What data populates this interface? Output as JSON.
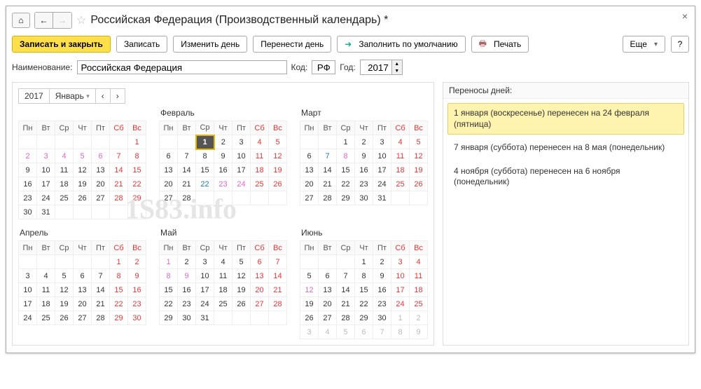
{
  "titlebar": {
    "title": "Российская Федерация (Производственный календарь) *"
  },
  "toolbar": {
    "save_close": "Записать и закрыть",
    "save": "Записать",
    "change_day": "Изменить день",
    "move_day": "Перенести день",
    "fill_default": "Заполнить по умолчанию",
    "print": "Печать",
    "more": "Еще",
    "help": "?"
  },
  "form": {
    "name_label": "Наименование:",
    "name_value": "Российская Федерация",
    "code_label": "Код:",
    "code_value": "РФ",
    "year_label": "Год:",
    "year_value": "2017"
  },
  "year_nav": {
    "year": "2017",
    "month": "Январь"
  },
  "dow": [
    "Пн",
    "Вт",
    "Ср",
    "Чт",
    "Пт",
    "Сб",
    "Вс"
  ],
  "months": [
    {
      "name": "Январь",
      "rows": [
        [
          {
            "": null
          },
          {
            "": null
          },
          {
            "": null
          },
          {
            "": null
          },
          {
            "": null
          },
          {
            "": null
          },
          {
            "v": "1",
            "c": "wknd"
          }
        ],
        [
          {
            "v": "2",
            "c": "hol"
          },
          {
            "v": "3",
            "c": "hol"
          },
          {
            "v": "4",
            "c": "hol"
          },
          {
            "v": "5",
            "c": "hol"
          },
          {
            "v": "6",
            "c": "hol"
          },
          {
            "v": "7",
            "c": "wknd"
          },
          {
            "v": "8",
            "c": "wknd"
          }
        ],
        [
          {
            "v": "9"
          },
          {
            "v": "10"
          },
          {
            "v": "11"
          },
          {
            "v": "12"
          },
          {
            "v": "13"
          },
          {
            "v": "14",
            "c": "wknd"
          },
          {
            "v": "15",
            "c": "wknd"
          }
        ],
        [
          {
            "v": "16"
          },
          {
            "v": "17"
          },
          {
            "v": "18"
          },
          {
            "v": "19"
          },
          {
            "v": "20"
          },
          {
            "v": "21",
            "c": "wknd"
          },
          {
            "v": "22",
            "c": "wknd"
          }
        ],
        [
          {
            "v": "23"
          },
          {
            "v": "24"
          },
          {
            "v": "25"
          },
          {
            "v": "26"
          },
          {
            "v": "27"
          },
          {
            "v": "28",
            "c": "wknd"
          },
          {
            "v": "29",
            "c": "wknd"
          }
        ],
        [
          {
            "v": "30"
          },
          {
            "v": "31"
          },
          {
            "": null
          },
          {
            "": null
          },
          {
            "": null
          },
          {
            "": null
          },
          {
            "": null
          }
        ]
      ]
    },
    {
      "name": "Февраль",
      "rows": [
        [
          {
            "": null
          },
          {
            "": null
          },
          {
            "v": "1",
            "c": "sel"
          },
          {
            "v": "2"
          },
          {
            "v": "3"
          },
          {
            "v": "4",
            "c": "wknd"
          },
          {
            "v": "5",
            "c": "wknd"
          }
        ],
        [
          {
            "v": "6"
          },
          {
            "v": "7"
          },
          {
            "v": "8"
          },
          {
            "v": "9"
          },
          {
            "v": "10"
          },
          {
            "v": "11",
            "c": "wknd"
          },
          {
            "v": "12",
            "c": "wknd"
          }
        ],
        [
          {
            "v": "13"
          },
          {
            "v": "14"
          },
          {
            "v": "15"
          },
          {
            "v": "16"
          },
          {
            "v": "17"
          },
          {
            "v": "18",
            "c": "wknd"
          },
          {
            "v": "19",
            "c": "wknd"
          }
        ],
        [
          {
            "v": "20"
          },
          {
            "v": "21"
          },
          {
            "v": "22",
            "c": "pre"
          },
          {
            "v": "23",
            "c": "hol"
          },
          {
            "v": "24",
            "c": "hol"
          },
          {
            "v": "25",
            "c": "wknd"
          },
          {
            "v": "26",
            "c": "wknd"
          }
        ],
        [
          {
            "v": "27"
          },
          {
            "v": "28"
          },
          {
            "": null
          },
          {
            "": null
          },
          {
            "": null
          },
          {
            "": null
          },
          {
            "": null
          }
        ]
      ]
    },
    {
      "name": "Март",
      "rows": [
        [
          {
            "": null
          },
          {
            "": null
          },
          {
            "v": "1"
          },
          {
            "v": "2"
          },
          {
            "v": "3"
          },
          {
            "v": "4",
            "c": "wknd"
          },
          {
            "v": "5",
            "c": "wknd"
          }
        ],
        [
          {
            "v": "6"
          },
          {
            "v": "7",
            "c": "pre"
          },
          {
            "v": "8",
            "c": "hol"
          },
          {
            "v": "9"
          },
          {
            "v": "10"
          },
          {
            "v": "11",
            "c": "wknd"
          },
          {
            "v": "12",
            "c": "wknd"
          }
        ],
        [
          {
            "v": "13"
          },
          {
            "v": "14"
          },
          {
            "v": "15"
          },
          {
            "v": "16"
          },
          {
            "v": "17"
          },
          {
            "v": "18",
            "c": "wknd"
          },
          {
            "v": "19",
            "c": "wknd"
          }
        ],
        [
          {
            "v": "20"
          },
          {
            "v": "21"
          },
          {
            "v": "22"
          },
          {
            "v": "23"
          },
          {
            "v": "24"
          },
          {
            "v": "25",
            "c": "wknd"
          },
          {
            "v": "26",
            "c": "wknd"
          }
        ],
        [
          {
            "v": "27"
          },
          {
            "v": "28"
          },
          {
            "v": "29"
          },
          {
            "v": "30"
          },
          {
            "v": "31"
          },
          {
            "": null
          },
          {
            "": null
          }
        ]
      ]
    },
    {
      "name": "Апрель",
      "rows": [
        [
          {
            "": null
          },
          {
            "": null
          },
          {
            "": null
          },
          {
            "": null
          },
          {
            "": null
          },
          {
            "v": "1",
            "c": "wknd"
          },
          {
            "v": "2",
            "c": "wknd"
          }
        ],
        [
          {
            "v": "3"
          },
          {
            "v": "4"
          },
          {
            "v": "5"
          },
          {
            "v": "6"
          },
          {
            "v": "7"
          },
          {
            "v": "8",
            "c": "wknd"
          },
          {
            "v": "9",
            "c": "wknd"
          }
        ],
        [
          {
            "v": "10"
          },
          {
            "v": "11"
          },
          {
            "v": "12"
          },
          {
            "v": "13"
          },
          {
            "v": "14"
          },
          {
            "v": "15",
            "c": "wknd"
          },
          {
            "v": "16",
            "c": "wknd"
          }
        ],
        [
          {
            "v": "17"
          },
          {
            "v": "18"
          },
          {
            "v": "19"
          },
          {
            "v": "20"
          },
          {
            "v": "21"
          },
          {
            "v": "22",
            "c": "wknd"
          },
          {
            "v": "23",
            "c": "wknd"
          }
        ],
        [
          {
            "v": "24"
          },
          {
            "v": "25"
          },
          {
            "v": "26"
          },
          {
            "v": "27"
          },
          {
            "v": "28"
          },
          {
            "v": "29",
            "c": "wknd"
          },
          {
            "v": "30",
            "c": "wknd"
          }
        ]
      ]
    },
    {
      "name": "Май",
      "rows": [
        [
          {
            "v": "1",
            "c": "hol"
          },
          {
            "v": "2"
          },
          {
            "v": "3"
          },
          {
            "v": "4"
          },
          {
            "v": "5"
          },
          {
            "v": "6",
            "c": "wknd"
          },
          {
            "v": "7",
            "c": "wknd"
          }
        ],
        [
          {
            "v": "8",
            "c": "hol"
          },
          {
            "v": "9",
            "c": "hol"
          },
          {
            "v": "10"
          },
          {
            "v": "11"
          },
          {
            "v": "12"
          },
          {
            "v": "13",
            "c": "wknd"
          },
          {
            "v": "14",
            "c": "wknd"
          }
        ],
        [
          {
            "v": "15"
          },
          {
            "v": "16"
          },
          {
            "v": "17"
          },
          {
            "v": "18"
          },
          {
            "v": "19"
          },
          {
            "v": "20",
            "c": "wknd"
          },
          {
            "v": "21",
            "c": "wknd"
          }
        ],
        [
          {
            "v": "22"
          },
          {
            "v": "23"
          },
          {
            "v": "24"
          },
          {
            "v": "25"
          },
          {
            "v": "26"
          },
          {
            "v": "27",
            "c": "wknd"
          },
          {
            "v": "28",
            "c": "wknd"
          }
        ],
        [
          {
            "v": "29"
          },
          {
            "v": "30"
          },
          {
            "v": "31"
          },
          {
            "": null
          },
          {
            "": null
          },
          {
            "": null
          },
          {
            "": null
          }
        ]
      ]
    },
    {
      "name": "Июнь",
      "rows": [
        [
          {
            "": null
          },
          {
            "": null
          },
          {
            "": null
          },
          {
            "v": "1"
          },
          {
            "v": "2"
          },
          {
            "v": "3",
            "c": "wknd"
          },
          {
            "v": "4",
            "c": "wknd"
          }
        ],
        [
          {
            "v": "5"
          },
          {
            "v": "6"
          },
          {
            "v": "7"
          },
          {
            "v": "8"
          },
          {
            "v": "9"
          },
          {
            "v": "10",
            "c": "wknd"
          },
          {
            "v": "11",
            "c": "wknd"
          }
        ],
        [
          {
            "v": "12",
            "c": "hol"
          },
          {
            "v": "13"
          },
          {
            "v": "14"
          },
          {
            "v": "15"
          },
          {
            "v": "16"
          },
          {
            "v": "17",
            "c": "wknd"
          },
          {
            "v": "18",
            "c": "wknd"
          }
        ],
        [
          {
            "v": "19"
          },
          {
            "v": "20"
          },
          {
            "v": "21"
          },
          {
            "v": "22"
          },
          {
            "v": "23"
          },
          {
            "v": "24",
            "c": "wknd"
          },
          {
            "v": "25",
            "c": "wknd"
          }
        ],
        [
          {
            "v": "26"
          },
          {
            "v": "27"
          },
          {
            "v": "28"
          },
          {
            "v": "29"
          },
          {
            "v": "30"
          },
          {
            "v": "1",
            "c": "mute"
          },
          {
            "v": "2",
            "c": "mute"
          }
        ],
        [
          {
            "v": "3",
            "c": "mute"
          },
          {
            "v": "4",
            "c": "mute"
          },
          {
            "v": "5",
            "c": "mute"
          },
          {
            "v": "6",
            "c": "mute"
          },
          {
            "v": "7",
            "c": "mute"
          },
          {
            "v": "8",
            "c": "mute"
          },
          {
            "v": "9",
            "c": "mute"
          }
        ]
      ]
    }
  ],
  "side": {
    "title": "Переносы дней:",
    "items": [
      "1 января (воскресенье) перенесен на 24 февраля (пятница)",
      "7 января (суббота) перенесен на 8 мая (понедельник)",
      "4 ноября (суббота) перенесен на 6 ноября (понедельник)"
    ]
  },
  "watermark": "1S83.info"
}
